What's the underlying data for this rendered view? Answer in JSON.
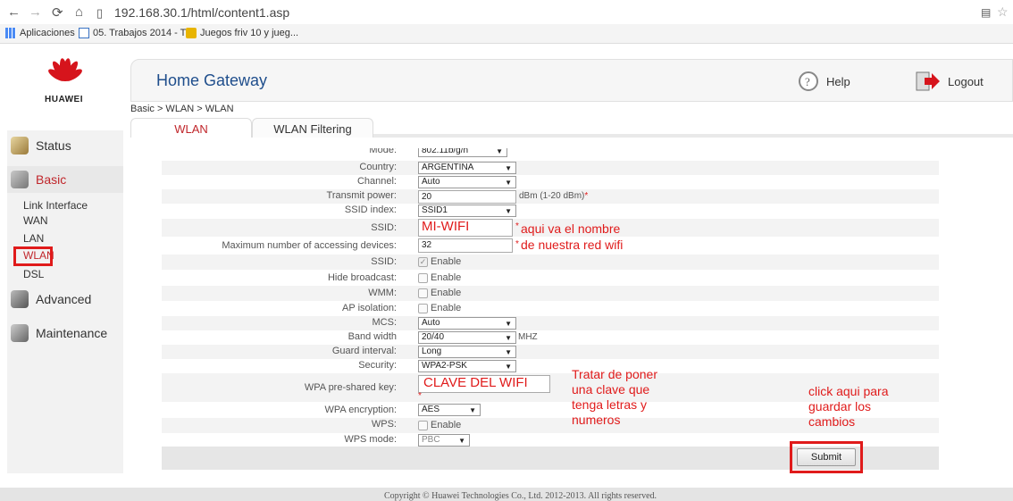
{
  "browser": {
    "url": "192.168.30.1/html/content1.asp",
    "bookmarks": [
      "Aplicaciones",
      "05. Trabajos 2014 - T...",
      "Juegos friv 10 y jueg..."
    ]
  },
  "brand": "HUAWEI",
  "header": {
    "title": "Home Gateway",
    "help": "Help",
    "logout": "Logout"
  },
  "breadcrumb": "Basic > WLAN > WLAN",
  "tabs": [
    "WLAN",
    "WLAN Filtering"
  ],
  "sidebar": {
    "status": "Status",
    "basic": "Basic",
    "sub": [
      "Link Interface",
      "WAN",
      "LAN",
      "WLAN",
      "DSL"
    ],
    "advanced": "Advanced",
    "maintenance": "Maintenance"
  },
  "form": {
    "mode_label": "Mode:",
    "mode_value": "802.11b/g/n",
    "country_label": "Country:",
    "country_value": "ARGENTINA",
    "channel_label": "Channel:",
    "channel_value": "Auto",
    "power_label": "Transmit power:",
    "power_value": "20",
    "power_unit": "dBm (1-20 dBm)",
    "ssid_index_label": "SSID index:",
    "ssid_index_value": "SSID1",
    "ssid_label": "SSID:",
    "ssid_value": "MI-WIFI",
    "max_label": "Maximum number of accessing devices:",
    "max_value": "32",
    "ssid_enable_label": "SSID:",
    "hide_label": "Hide broadcast:",
    "wmm_label": "WMM:",
    "ap_label": "AP isolation:",
    "enable": "Enable",
    "mcs_label": "MCS:",
    "mcs_value": "Auto",
    "bw_label": "Band width",
    "bw_value": "20/40",
    "bw_unit": "MHZ",
    "gi_label": "Guard interval:",
    "gi_value": "Long",
    "sec_label": "Security:",
    "sec_value": "WPA2-PSK",
    "psk_label": "WPA pre-shared key:",
    "psk_value": "CLAVE DEL WIFI",
    "enc_label": "WPA encryption:",
    "enc_value": "AES",
    "wps_label": "WPS:",
    "wps_mode_label": "WPS mode:",
    "wps_mode_value": "PBC",
    "submit": "Submit"
  },
  "annotations": {
    "ssid_note_1": "aqui va el nombre",
    "ssid_note_2": "de nuestra red wifi",
    "key_note": [
      "Tratar de poner",
      "una clave que",
      "tenga letras y",
      "numeros"
    ],
    "submit_note": [
      "click aqui para",
      "guardar los",
      "cambios"
    ]
  },
  "footer": "Copyright © Huawei Technologies Co., Ltd. 2012-2013. All rights reserved.",
  "colors": {
    "accent": "#c0262b",
    "highlight": "#e01b1b",
    "title": "#1f4e8c"
  }
}
